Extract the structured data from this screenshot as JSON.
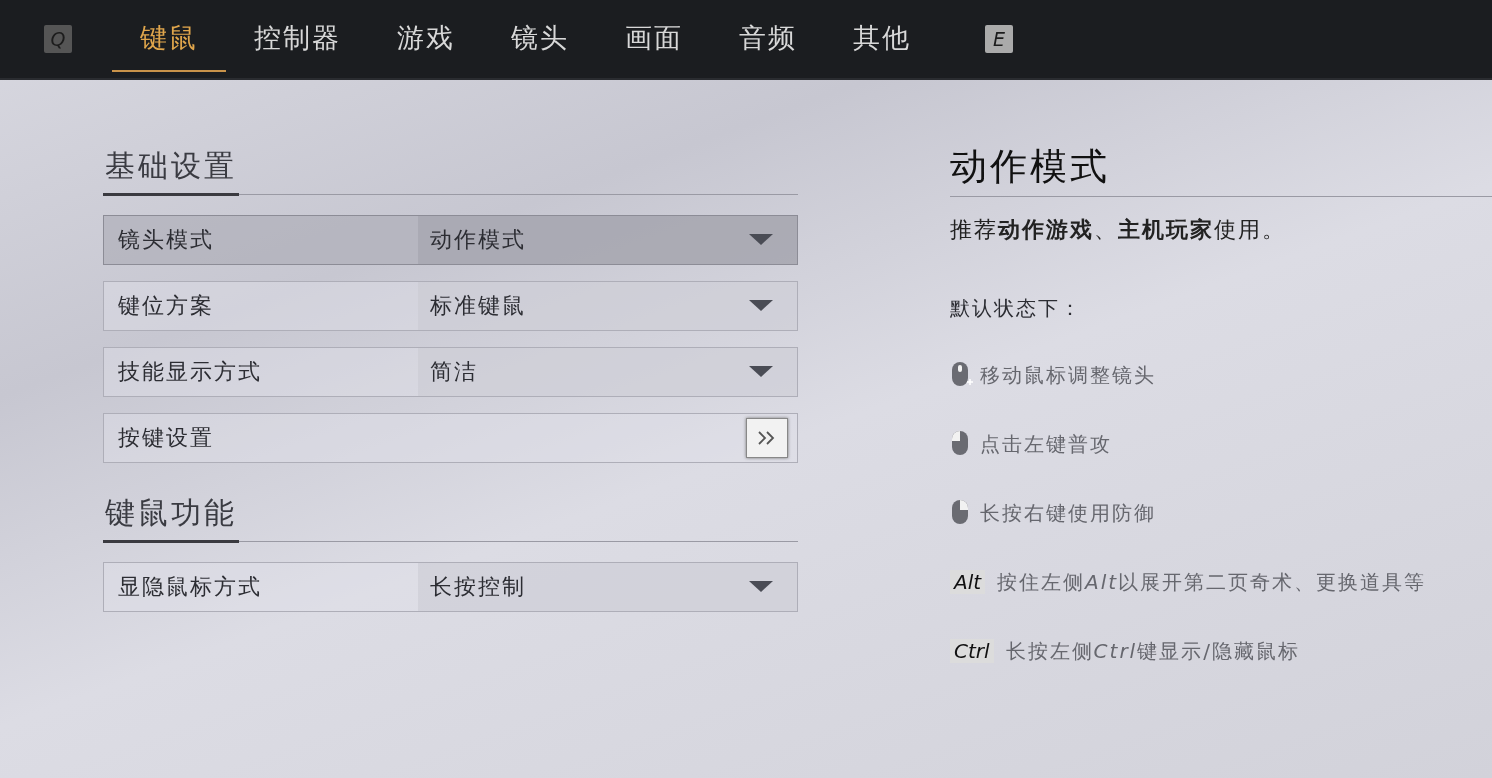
{
  "top_bar": {
    "prev_key": "Q",
    "next_key": "E",
    "tabs": [
      {
        "label": "键鼠",
        "selected": true
      },
      {
        "label": "控制器",
        "selected": false
      },
      {
        "label": "游戏",
        "selected": false
      },
      {
        "label": "镜头",
        "selected": false
      },
      {
        "label": "画面",
        "selected": false
      },
      {
        "label": "音频",
        "selected": false
      },
      {
        "label": "其他",
        "selected": false
      }
    ]
  },
  "sections": [
    {
      "title": "基础设置",
      "rows": [
        {
          "kind": "dropdown",
          "label": "镜头模式",
          "value": "动作模式",
          "selected": true
        },
        {
          "kind": "dropdown",
          "label": "键位方案",
          "value": "标准键鼠",
          "selected": false
        },
        {
          "kind": "dropdown",
          "label": "技能显示方式",
          "value": "简洁",
          "selected": false
        },
        {
          "kind": "link",
          "label": "按键设置",
          "selected": false
        }
      ]
    },
    {
      "title": "键鼠功能",
      "rows": [
        {
          "kind": "dropdown",
          "label": "显隐鼠标方式",
          "value": "长按控制",
          "selected": false
        }
      ]
    }
  ],
  "detail": {
    "title": "动作模式",
    "description": "推荐**动作游戏**、**主机玩家**使用。",
    "subtitle": "默认状态下：",
    "hints": [
      {
        "kind": "mouse-move",
        "text": "移动鼠标调整镜头"
      },
      {
        "kind": "mouse-left",
        "text": "点击左键普攻"
      },
      {
        "kind": "mouse-right",
        "text": "长按右键使用防御"
      },
      {
        "kind": "key",
        "key": "Alt",
        "text_before": "按住左侧",
        "key_word": "Alt",
        "text_after": "以展开第二页奇术、更换道具等"
      },
      {
        "kind": "key",
        "key": "Ctrl",
        "text_before": "长按左侧",
        "key_word": "Ctrl",
        "text_after": "键显示/隐藏鼠标"
      }
    ]
  }
}
